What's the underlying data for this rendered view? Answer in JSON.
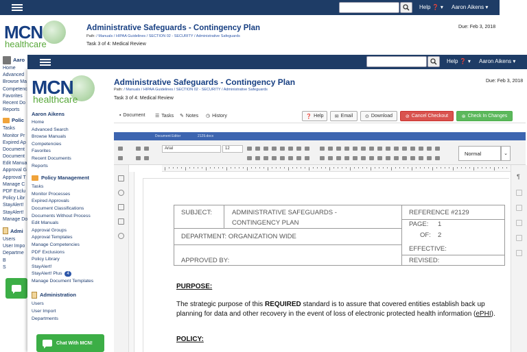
{
  "app": {
    "logo_mcn": "MCN",
    "logo_healthcare": "healthcare",
    "user_name": "Aaron Aikens",
    "help_label": "Help"
  },
  "back": {
    "page_title": "Administrative Safeguards - Contingency Plan",
    "path": {
      "prefix": "Path:",
      "parts": [
        "/ Manuals",
        "/ HIPAA Guidelines",
        "/ SECTION 02 - SECURITY",
        "/ Administrative Safeguards"
      ]
    },
    "task": "Task 3 of 4: Medical Review",
    "due": "Due: Feb 3, 2018",
    "sidebar": {
      "user": "Aaro",
      "items": [
        "Home",
        "Advanced",
        "Browse Ma",
        "Competenc",
        "Favorites",
        "Recent Do",
        "Reports"
      ],
      "policy_head": "Polic",
      "policy_items": [
        "Tasks",
        "Monitor Pr",
        "Expired Ap",
        "Document",
        "Document",
        "Edit Manua",
        "Approval G",
        "Approval T",
        "Manage C",
        "PDF Exclu",
        "Policy Libr",
        "StayAlert!",
        "StayAlert!",
        "Manage Do"
      ],
      "admin_head": "Admi",
      "admin_items": [
        "Users",
        "User Impo",
        "Departme",
        "B",
        "S"
      ]
    }
  },
  "front": {
    "page_title": "Administrative Safeguards - Contingency Plan",
    "path": {
      "prefix": "Path:",
      "parts": [
        "/ Manuals",
        "/ HIPAA Guidelines",
        "/ SECTION 02 - SECURITY",
        "/ Administrative Safeguards"
      ]
    },
    "task": "Task 3 of 4: Medical Review",
    "due": "Due: Feb 3, 2018",
    "sidebar": {
      "user": "Aaron Aikens",
      "items": [
        "Home",
        "Advanced Search",
        "Browse Manuals",
        "Competencies",
        "Favorites",
        "Recent Documents",
        "Reports"
      ],
      "policy_head": "Policy Management",
      "policy_items": [
        "Tasks",
        "Monitor Processes",
        "Expired Approvals",
        "Document Classifications",
        "Documents Without Process",
        "Edit Manuals",
        "Approval Groups",
        "Approval Templates",
        "Manage Competencies",
        "PDF Exclusions",
        "Policy Library",
        "StayAlert!"
      ],
      "stayalert_plus": "StayAlert! Plus",
      "stayalert_plus_count": "4",
      "manage_templates": "Manage Document Templates",
      "admin_head": "Administration",
      "admin_items": [
        "Users",
        "User Import",
        "Departments"
      ]
    },
    "chat_label": "Chat With MCN!",
    "tabs": [
      "Document",
      "Tasks",
      "Notes",
      "History"
    ],
    "actions": {
      "help": "Help",
      "email": "Email",
      "download": "Download",
      "cancel": "Cancel Checkout",
      "checkin": "Check In Changes"
    },
    "editor": {
      "title": "Document Editor",
      "filename": "2129.docx",
      "font": "Arial",
      "size": "12",
      "style": "Normal"
    },
    "document": {
      "subject_label": "SUBJECT:",
      "subject_line1": "ADMINISTRATIVE SAFEGUARDS -",
      "subject_line2": "CONTINGENCY PLAN",
      "reference": "REFERENCE #2129",
      "page_label": "PAGE:",
      "page_value": "1",
      "of_label": "OF:",
      "of_value": "2",
      "department": "DEPARTMENT:  ORGANIZATION WIDE",
      "effective": "EFFECTIVE:",
      "approved_by": "APPROVED BY:",
      "revised": "REVISED:",
      "purpose_heading": "PURPOSE:",
      "purpose_pre": "The strategic purpose of this ",
      "purpose_bold": "REQUIRED",
      "purpose_post": " standard is to assure that covered entities establish back up planning for data and other recovery in the event of loss of electronic protected health information (",
      "purpose_link": "ePHI",
      "purpose_end": ").",
      "policy_heading": "POLICY:"
    }
  }
}
